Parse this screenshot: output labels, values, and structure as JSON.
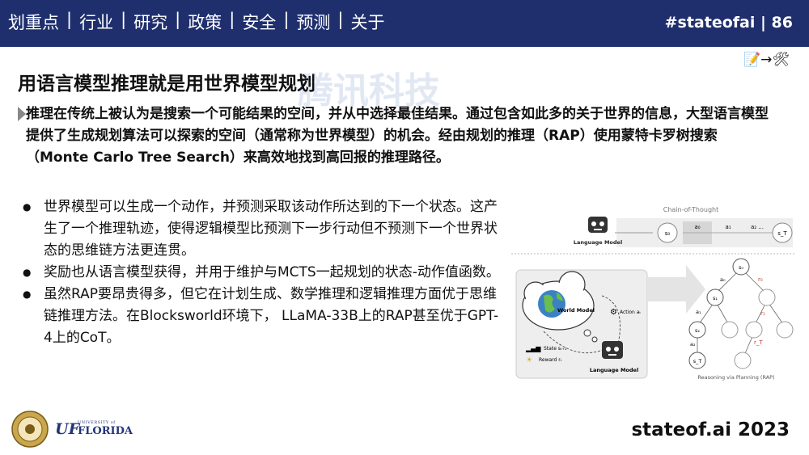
{
  "nav": {
    "items": [
      "划重点",
      "行业",
      "研究",
      "政策",
      "安全",
      "预测",
      "关于"
    ],
    "separator": "|"
  },
  "header": {
    "tag": "#stateofai | 86"
  },
  "slide": {
    "title": "用语言模型推理就是用世界模型规划",
    "watermark": "腾讯科技",
    "intro": "推理在传统上被认为是搜索一个可能结果的空间，并从中选择最佳结果。通过包含如此多的关于世界的信息，大型语言模型提供了生成规划算法可以探索的空间（通常称为世界模型）的机会。经由规划的推理（RAP）使用蒙特卡罗树搜索（Monte Carlo Tree Search）来高效地找到高回报的推理路径。",
    "bullets": [
      "世界模型可以生成一个动作，并预测采取该动作所达到的下一个状态。这产生了一个推理轨迹，使得逻辑模型比预测下一步行动但不预测下一个世界状态的思维链方法更连贯。",
      "奖励也从语言模型获得，并用于维护与MCTS一起规划的状态-动作值函数。",
      "虽然RAP要昂贵得多，但它在计划生成、数学推理和逻辑推理方面优于思维链推理方法。在Blocksworld环境下， LLaMA-33B上的RAP甚至优于GPT-4上的CoT。"
    ]
  },
  "diagram": {
    "cot_label": "Chain-of-Thought",
    "lm_label_top": "Language Model",
    "lm_label_bottom": "Language Model",
    "s0": "s₀",
    "a0": "a₀",
    "a1": "a₁",
    "a2": "a₂ ...",
    "sT": "s_T",
    "world_model": "World Model",
    "action": "Action aₜ",
    "state": "State sₜ₊₁",
    "reward": "Reward rₜ",
    "tree_s0": "s₀",
    "tree_s1": "s₁",
    "tree_s2": "s₂",
    "tree_sT": "s_T",
    "tree_a0": "a₀",
    "tree_a1": "a₁",
    "tree_a2": "a₂",
    "r0": "r₀",
    "r1": "r₁",
    "rT": "r_T",
    "caption": "Reasoning via Planning (RAP)"
  },
  "footer": {
    "university_small": "UNIVERSITY of",
    "university_big": "FLORIDA",
    "uf_mark": "UF",
    "site": "stateof.ai 2023"
  },
  "icons": {
    "memo": "memo-icon",
    "tools": "tools-icon"
  },
  "colors": {
    "header_bg": "#1f2f6e",
    "watermark": "#c9d7ea",
    "reward_red": "#c0392b"
  }
}
